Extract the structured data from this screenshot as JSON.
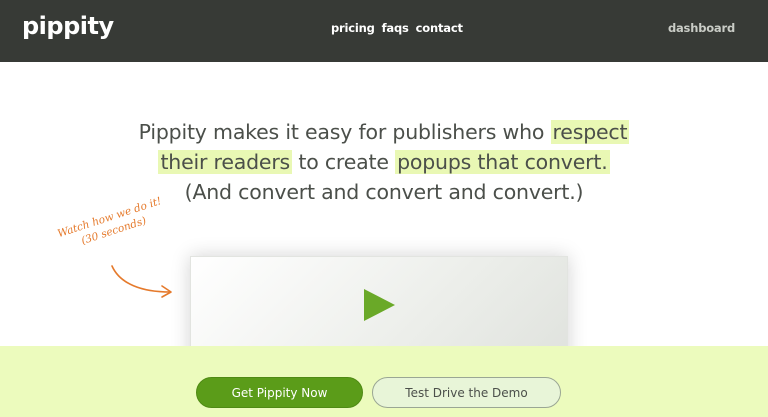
{
  "header": {
    "logo": "pippity",
    "nav": [
      {
        "label": "pricing"
      },
      {
        "label": "faqs"
      },
      {
        "label": "contact"
      }
    ],
    "dashboard": "dashboard"
  },
  "hero": {
    "line1_pre": "Pippity makes it easy for publishers who ",
    "line1_hl": "respect",
    "line2_hl": "their readers",
    "line2_mid": " to create ",
    "line2_hl2": "popups that convert.",
    "line3": "(And convert and convert and convert.)"
  },
  "annotation": {
    "line1": "Watch how we do it!",
    "line2": "(30 seconds)"
  },
  "video": {
    "icon": "play-icon"
  },
  "cta": {
    "primary": "Get Pippity Now",
    "secondary": "Test Drive the Demo"
  },
  "colors": {
    "header_bg": "#373a36",
    "highlight": "#e9f8b4",
    "accent_green": "#5b9c19",
    "annotation_orange": "#e57a2c",
    "cta_bar": "#ecfbbd"
  }
}
